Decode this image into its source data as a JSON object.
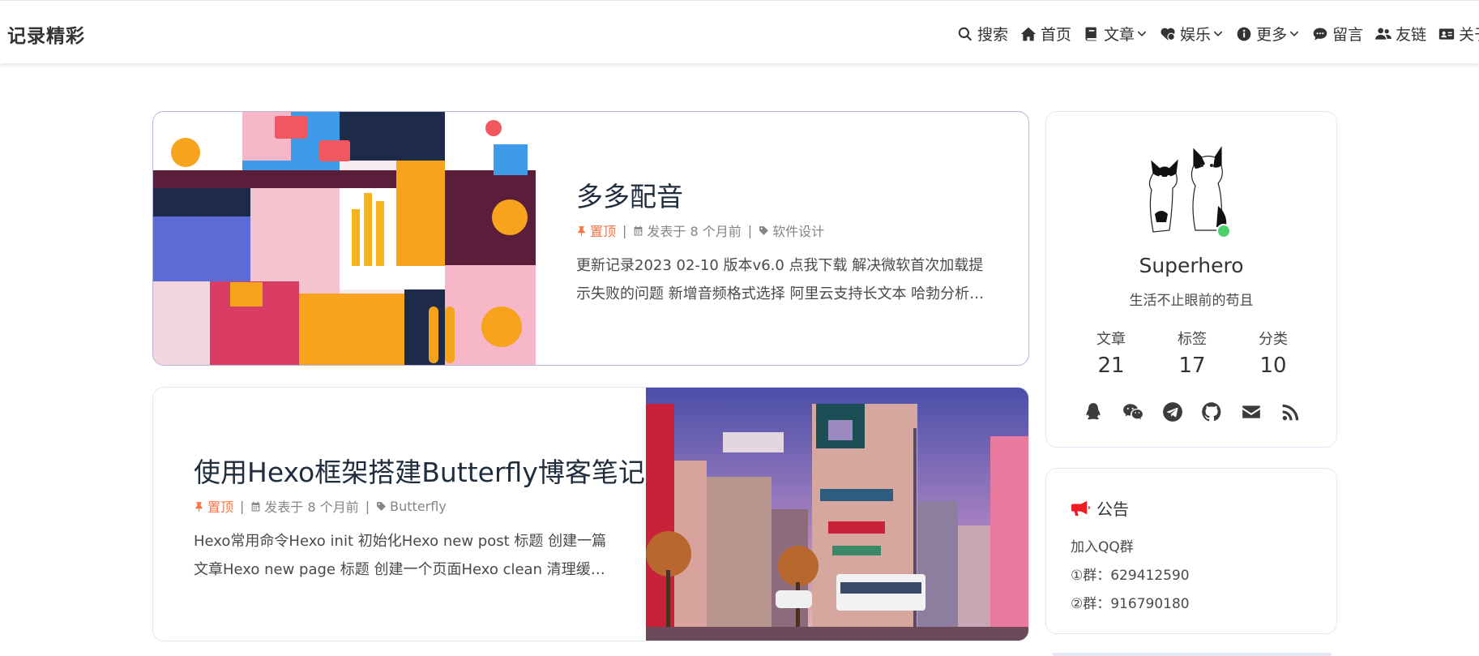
{
  "nav": {
    "site_name": "记录精彩",
    "items": [
      {
        "label": "搜索",
        "icon": "search-icon",
        "dropdown": false
      },
      {
        "label": "首页",
        "icon": "home-icon",
        "dropdown": false
      },
      {
        "label": "文章",
        "icon": "book-icon",
        "dropdown": true
      },
      {
        "label": "娱乐",
        "icon": "heart-icon",
        "dropdown": true
      },
      {
        "label": "更多",
        "icon": "info-icon",
        "dropdown": true
      },
      {
        "label": "留言",
        "icon": "comment-icon",
        "dropdown": false
      },
      {
        "label": "友链",
        "icon": "user-group-icon",
        "dropdown": false
      },
      {
        "label": "关于",
        "icon": "id-card-icon",
        "dropdown": false
      }
    ]
  },
  "posts": [
    {
      "title": "多多配音",
      "sticky_label": "置顶",
      "date_label": "发表于 8 个月前",
      "category": "软件设计",
      "excerpt": "更新记录2023 02-10 版本v6.0 点我下载 解决微软首次加载提示失败的问题 新增音频格式选择 阿里云支持长文本 哈勃分析报告..."
    },
    {
      "title": "使用Hexo框架搭建Butterfly博客笔记",
      "sticky_label": "置顶",
      "date_label": "发表于 8 个月前",
      "category": "Butterfly",
      "excerpt": "Hexo常用命令Hexo init 初始化Hexo new post 标题 创建一篇文章Hexo new page 标题 创建一个页面Hexo clean 清理缓存He..."
    }
  ],
  "author": {
    "name": "Superhero",
    "description": "生活不止眼前的苟且",
    "stats": [
      {
        "label": "文章",
        "value": "21"
      },
      {
        "label": "标签",
        "value": "17"
      },
      {
        "label": "分类",
        "value": "10"
      }
    ],
    "socials": [
      "qq-icon",
      "wechat-icon",
      "telegram-icon",
      "github-icon",
      "email-icon",
      "rss-icon"
    ]
  },
  "announcement": {
    "title": "公告",
    "lines": [
      "加入QQ群",
      "①群：629412590",
      "②群：916790180"
    ]
  },
  "colors": {
    "sticky": "#ff7242",
    "announce_icon": "#ee1b24",
    "status_online": "#4ed06a"
  }
}
